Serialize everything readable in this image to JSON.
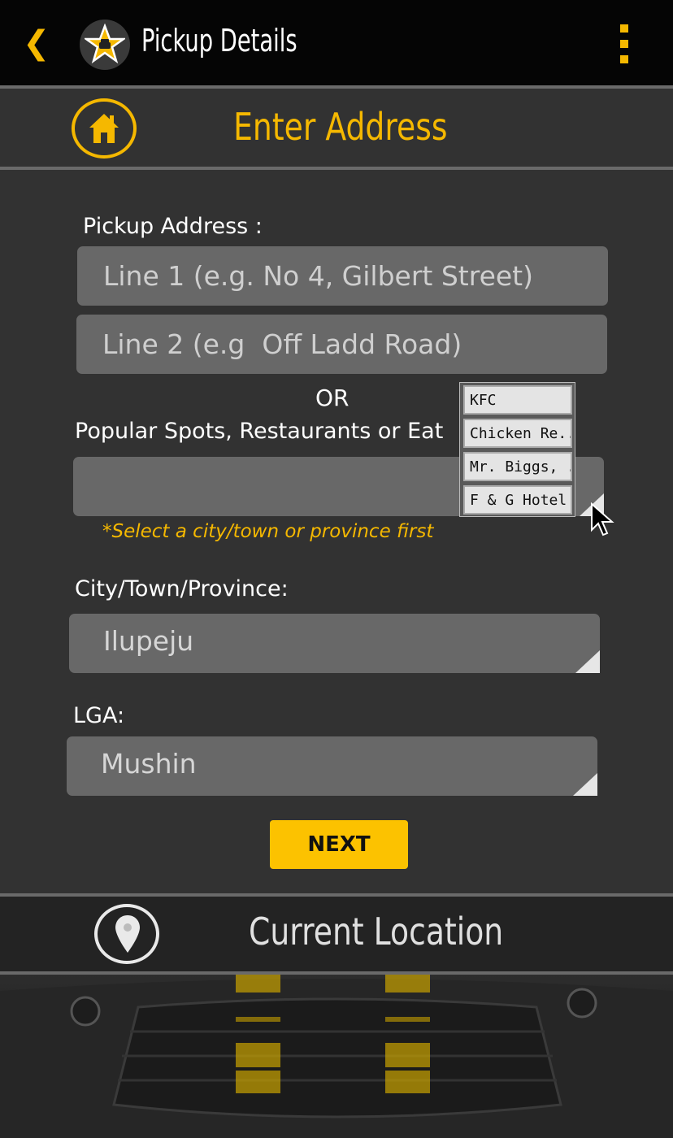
{
  "appbar": {
    "title": "Pickup Details",
    "back_icon": "chevron-left-icon",
    "menu_icon": "more-vertical-icon",
    "logo_icon": "taxi-star-icon"
  },
  "header": {
    "title": "Enter Address",
    "home_icon": "home-icon"
  },
  "form": {
    "pickup_label": "Pickup Address :",
    "line1_placeholder": "Line 1 (e.g. No 4, Gilbert Street)",
    "line2_placeholder": "Line 2 (e.g  Off Ladd Road)",
    "or_text": "OR",
    "spots_label": "Popular Spots, Restaurants or Eat",
    "spots_hint": "*Select a city/town or province first",
    "city_label": "City/Town/Province:",
    "city_value": "Ilupeju",
    "lga_label": "LGA:",
    "lga_value": "Mushin",
    "next_label": "NEXT"
  },
  "dropdown": {
    "options": [
      "KFC",
      "Chicken Re...",
      "Mr. Biggs, ...",
      "F & G Hotel"
    ]
  },
  "footer": {
    "current_location": "Current Location",
    "pin_icon": "location-pin-icon"
  },
  "colors": {
    "accent": "#fcc200",
    "panel": "#323232",
    "field": "#686868"
  }
}
